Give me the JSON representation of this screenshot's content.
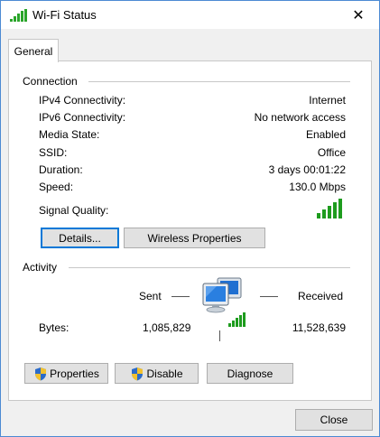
{
  "window": {
    "title": "Wi-Fi Status",
    "close_glyph": "✕",
    "accent_color": "#0078d7"
  },
  "tabs": [
    {
      "label": "General",
      "selected": true
    }
  ],
  "connection": {
    "title": "Connection",
    "rows": [
      {
        "label": "IPv4 Connectivity:",
        "value": "Internet"
      },
      {
        "label": "IPv6 Connectivity:",
        "value": "No network access"
      },
      {
        "label": "Media State:",
        "value": "Enabled"
      },
      {
        "label": "SSID:",
        "value": "Office"
      },
      {
        "label": "Duration:",
        "value": "3 days 00:01:22"
      },
      {
        "label": "Speed:",
        "value": "130.0 Mbps"
      }
    ],
    "signal_label": "Signal Quality:",
    "signal_bars": 5,
    "signal_color": "#1e9c1e",
    "buttons": {
      "details": "Details...",
      "wireless_properties": "Wireless Properties"
    }
  },
  "activity": {
    "title": "Activity",
    "sent_label": "Sent",
    "received_label": "Received",
    "bytes_label": "Bytes:",
    "bytes_sent": "1,085,829",
    "bytes_received": "11,528,639",
    "icon": "network-computers-icon"
  },
  "actions": {
    "properties": "Properties",
    "disable": "Disable",
    "diagnose": "Diagnose",
    "shield_icon": "uac-shield-icon"
  },
  "footer": {
    "close": "Close"
  }
}
